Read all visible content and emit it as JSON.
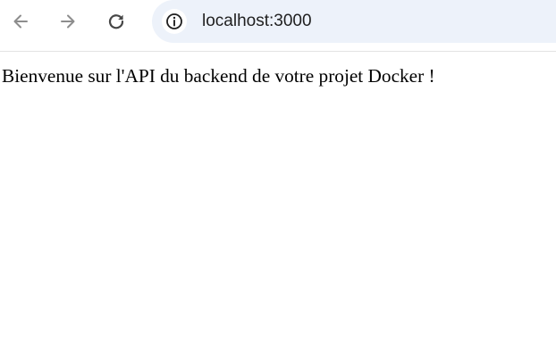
{
  "browser": {
    "nav": {
      "back_icon": "arrow-left-icon",
      "forward_icon": "arrow-right-icon",
      "reload_icon": "reload-icon"
    },
    "address_bar": {
      "site_info_icon": "info-icon",
      "url": "localhost:3000"
    },
    "colors": {
      "omnibox_background": "#edf2fa",
      "icon_disabled": "#8d8d8d",
      "icon_active": "#474747"
    }
  },
  "page": {
    "text": "Bienvenue sur l'API du backend de votre projet Docker !"
  }
}
